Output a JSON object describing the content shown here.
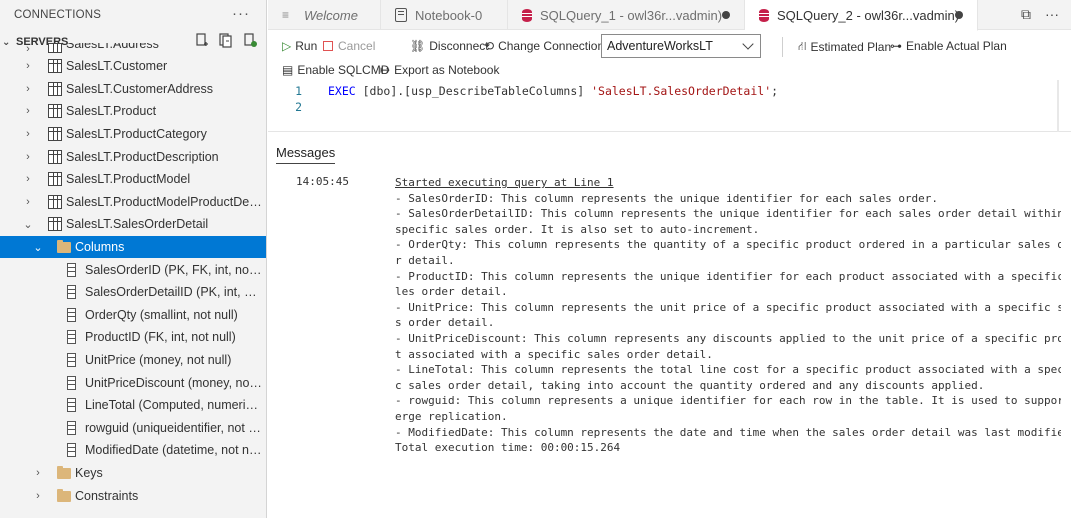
{
  "connections": {
    "title": "CONNECTIONS",
    "more": "···",
    "servers_label": "SERVERS"
  },
  "tree": {
    "items": [
      {
        "label": "SalesLT.Address",
        "level": 1,
        "icon": "table-icon",
        "chevron": "›",
        "partial": true
      },
      {
        "label": "SalesLT.Customer",
        "level": 1,
        "icon": "table-icon",
        "chevron": "›"
      },
      {
        "label": "SalesLT.CustomerAddress",
        "level": 1,
        "icon": "table-icon",
        "chevron": "›"
      },
      {
        "label": "SalesLT.Product",
        "level": 1,
        "icon": "table-icon",
        "chevron": "›"
      },
      {
        "label": "SalesLT.ProductCategory",
        "level": 1,
        "icon": "table-icon",
        "chevron": "›"
      },
      {
        "label": "SalesLT.ProductDescription",
        "level": 1,
        "icon": "table-icon",
        "chevron": "›"
      },
      {
        "label": "SalesLT.ProductModel",
        "level": 1,
        "icon": "table-icon",
        "chevron": "›"
      },
      {
        "label": "SalesLT.ProductModelProductDescri...",
        "level": 1,
        "icon": "table-icon",
        "chevron": "›"
      },
      {
        "label": "SalesLT.SalesOrderDetail",
        "level": 1,
        "icon": "table-icon",
        "chevron": "⌄"
      },
      {
        "label": "Columns",
        "level": 2,
        "icon": "folder-icon",
        "chevron": "⌄",
        "selected": true
      },
      {
        "label": "SalesOrderID (PK, FK, int, not null)",
        "level": 3,
        "icon": "column-icon"
      },
      {
        "label": "SalesOrderDetailID (PK, int, not ...",
        "level": 3,
        "icon": "column-icon"
      },
      {
        "label": "OrderQty (smallint, not null)",
        "level": 3,
        "icon": "column-icon"
      },
      {
        "label": "ProductID (FK, int, not null)",
        "level": 3,
        "icon": "column-icon"
      },
      {
        "label": "UnitPrice (money, not null)",
        "level": 3,
        "icon": "column-icon"
      },
      {
        "label": "UnitPriceDiscount (money, not ...",
        "level": 3,
        "icon": "column-icon"
      },
      {
        "label": "LineTotal (Computed, numeric(3...",
        "level": 3,
        "icon": "column-icon"
      },
      {
        "label": "rowguid (uniqueidentifier, not n...",
        "level": 3,
        "icon": "column-icon"
      },
      {
        "label": "ModifiedDate (datetime, not null)",
        "level": 3,
        "icon": "column-icon"
      },
      {
        "label": "Keys",
        "level": 2,
        "icon": "folder-icon",
        "chevron": "›"
      },
      {
        "label": "Constraints",
        "level": 2,
        "icon": "folder-icon",
        "chevron": "›"
      }
    ]
  },
  "tabs": [
    {
      "label": "Welcome",
      "icon": "welcome-icon",
      "italic": true
    },
    {
      "label": "Notebook-0",
      "icon": "notebook-icon"
    },
    {
      "label": "SQLQuery_1 - owl36r...vadmin)",
      "icon": "database-icon",
      "dirty": true
    },
    {
      "label": "SQLQuery_2 - owl36r...vadmin)",
      "icon": "database-icon",
      "dirty": true,
      "active": true
    }
  ],
  "tab_tools": {
    "split": "⧉",
    "more": "···"
  },
  "toolbar": {
    "run": "Run",
    "cancel": "Cancel",
    "disconnect": "Disconnect",
    "change_connection": "Change Connection",
    "database": "AdventureWorksLT",
    "estimated_plan": "Estimated Plan",
    "enable_actual_plan": "Enable Actual Plan",
    "enable_sqlcmd": "Enable SQLCMD",
    "export_notebook": "Export as Notebook"
  },
  "editor": {
    "line_numbers": [
      "1",
      "2"
    ],
    "line1": {
      "kw": "EXEC",
      "id": " [dbo].[usp_DescribeTableColumns] ",
      "str": "'SalesLT.SalesOrderDetail'",
      "end": ";"
    }
  },
  "messages": {
    "title": "Messages",
    "time": "14:05:45",
    "lines": [
      "Started executing query at Line 1",
      "- SalesOrderID: This column represents the unique identifier for each sales order.",
      "- SalesOrderDetailID: This column represents the unique identifier for each sales order detail within a",
      "specific sales order. It is also set to auto-increment.",
      "- OrderQty: This column represents the quantity of a specific product ordered in a particular sales orde",
      "r detail.",
      "- ProductID: This column represents the unique identifier for each product associated with a specific sa",
      "les order detail.",
      "- UnitPrice: This column represents the unit price of a specific product associated with a specific sale",
      "s order detail.",
      "- UnitPriceDiscount: This column represents any discounts applied to the unit price of a specific produc",
      "t associated with a specific sales order detail.",
      "- LineTotal: This column represents the total line cost for a specific product associated with a specifi",
      "c sales order detail, taking into account the quantity ordered and any discounts applied.",
      "- rowguid: This column represents a unique identifier for each row in the table. It is used to support m",
      "erge replication.",
      "- ModifiedDate: This column represents the date and time when the sales order detail was last modified.",
      "Total execution time: 00:00:15.264"
    ]
  },
  "colors": {
    "selected": "#0078d4",
    "keyword": "#0000ff",
    "string": "#a31515",
    "line_number": "#237893",
    "run": "#388a34"
  }
}
